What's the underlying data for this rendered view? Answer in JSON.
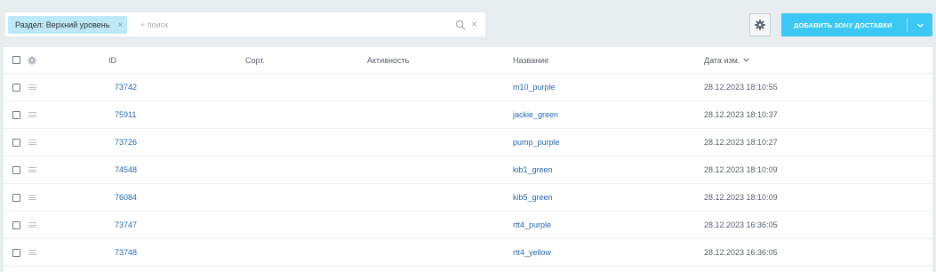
{
  "filter": {
    "tag_label": "Раздел: Верхний уровень",
    "tag_remove": "×",
    "search_placeholder": "+ поиск",
    "clear": "×"
  },
  "toolbar": {
    "add_label": "ДОБАВИТЬ ЗОНУ ДОСТАВКИ"
  },
  "table": {
    "headers": {
      "id": "ID",
      "sort": "Сорт.",
      "active": "Активность",
      "name": "Название",
      "date": "Дата изм."
    },
    "sort_indicator": "˅",
    "rows": [
      {
        "id": "73742",
        "name": "m10_purple",
        "date": "28.12.2023 18:10:55"
      },
      {
        "id": "75911",
        "name": "jackie_green",
        "date": "28.12.2023 18:10:37"
      },
      {
        "id": "73726",
        "name": "pump_purple",
        "date": "28.12.2023 18:10:27"
      },
      {
        "id": "74548",
        "name": "kib1_green",
        "date": "28.12.2023 18:10:09"
      },
      {
        "id": "76084",
        "name": "kib5_green",
        "date": "28.12.2023 18:10:09"
      },
      {
        "id": "73747",
        "name": "rtt4_purple",
        "date": "28.12.2023 16:36:05"
      },
      {
        "id": "73748",
        "name": "rtt4_yellow",
        "date": "28.12.2023 16:36:05"
      }
    ]
  },
  "colors": {
    "accent": "#3bc8f5",
    "tag_bg": "#bce8f8",
    "link": "#2067b0",
    "page_bg": "#e7ecef"
  },
  "icons": {
    "search": "search-icon",
    "settings": "gear-icon",
    "dropdown": "chevron-down-icon",
    "drag": "drag-handle-icon"
  }
}
